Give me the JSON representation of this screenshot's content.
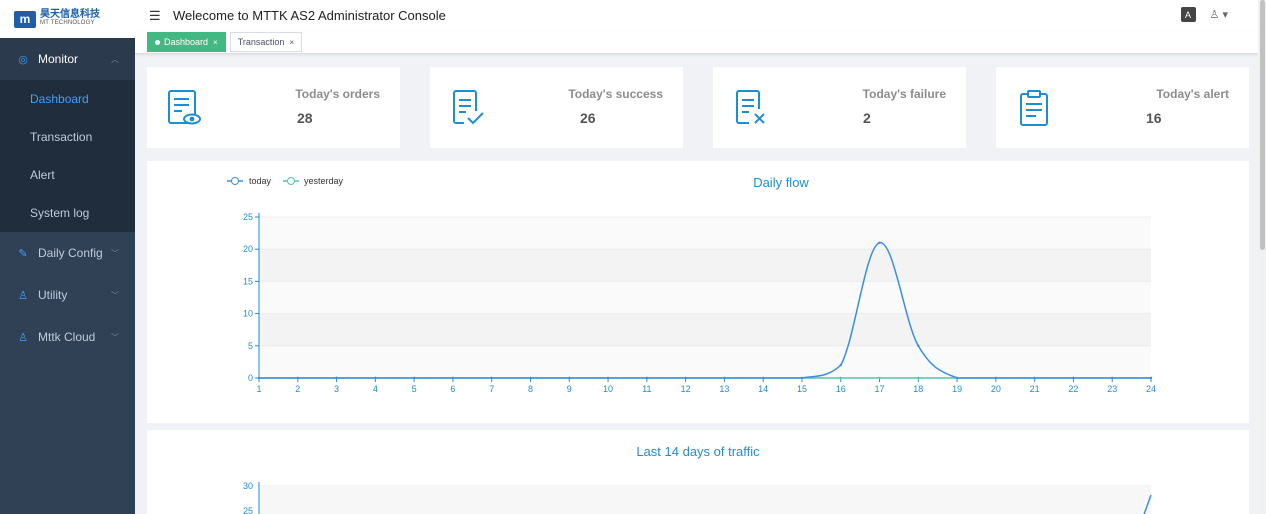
{
  "logo": {
    "mark": "m",
    "cn": "昊天信息科技",
    "en": "MT TECHNOLOGY"
  },
  "sidebar": {
    "monitor": {
      "label": "Monitor",
      "icon": "monitor-icon"
    },
    "subitems": [
      {
        "label": "Dashboard"
      },
      {
        "label": "Transaction"
      },
      {
        "label": "Alert"
      },
      {
        "label": "System log"
      }
    ],
    "groups": [
      {
        "label": "Daily Config",
        "icon": "edit-icon"
      },
      {
        "label": "Utility",
        "icon": "user-icon"
      },
      {
        "label": "Mttk Cloud",
        "icon": "user-icon"
      }
    ]
  },
  "header": {
    "title": "Welecome to MTTK AS2 Administrator Console",
    "lang_icon": "A"
  },
  "tags": [
    {
      "label": "Dashboard"
    },
    {
      "label": "Transaction"
    }
  ],
  "cards": [
    {
      "label": "Today's orders",
      "value": "28",
      "icon": "order-view-icon"
    },
    {
      "label": "Today's success",
      "value": "26",
      "icon": "doc-check-icon"
    },
    {
      "label": "Today's failure",
      "value": "2",
      "icon": "doc-x-icon"
    },
    {
      "label": "Today's alert",
      "value": "16",
      "icon": "clipboard-icon"
    }
  ],
  "colors": {
    "accent": "#409eff",
    "line_today": "#3b8ee0",
    "line_yesterday": "#4fc7a6",
    "sidebar_bg": "#304156",
    "tag_active": "#42b983"
  },
  "chart_data": [
    {
      "type": "line",
      "title": "Daily flow",
      "x": [
        "1",
        "2",
        "3",
        "4",
        "5",
        "6",
        "7",
        "8",
        "9",
        "10",
        "11",
        "12",
        "13",
        "14",
        "15",
        "16",
        "17",
        "18",
        "19",
        "20",
        "21",
        "22",
        "23",
        "24"
      ],
      "series": [
        {
          "name": "today",
          "values": [
            0,
            0,
            0,
            0,
            0,
            0,
            0,
            0,
            0,
            0,
            0,
            0,
            0,
            0,
            0,
            2,
            21,
            5,
            0,
            0,
            0,
            0,
            0,
            0
          ]
        },
        {
          "name": "yesterday",
          "values": [
            0,
            0,
            0,
            0,
            0,
            0,
            0,
            0,
            0,
            0,
            0,
            0,
            0,
            0,
            0,
            0,
            0,
            0,
            0,
            0,
            0,
            0,
            0,
            0
          ]
        }
      ],
      "yticks": [
        "0",
        "5",
        "10",
        "15",
        "20",
        "25"
      ],
      "ylim": [
        0,
        25
      ],
      "legend": "top-left",
      "grid": true
    },
    {
      "type": "line",
      "title": "Last 14 days of traffic",
      "yticks": [
        "25",
        "30"
      ],
      "ylim": [
        0,
        30
      ],
      "series": [
        {
          "name": "",
          "last_value": 28
        }
      ],
      "grid": true
    }
  ]
}
